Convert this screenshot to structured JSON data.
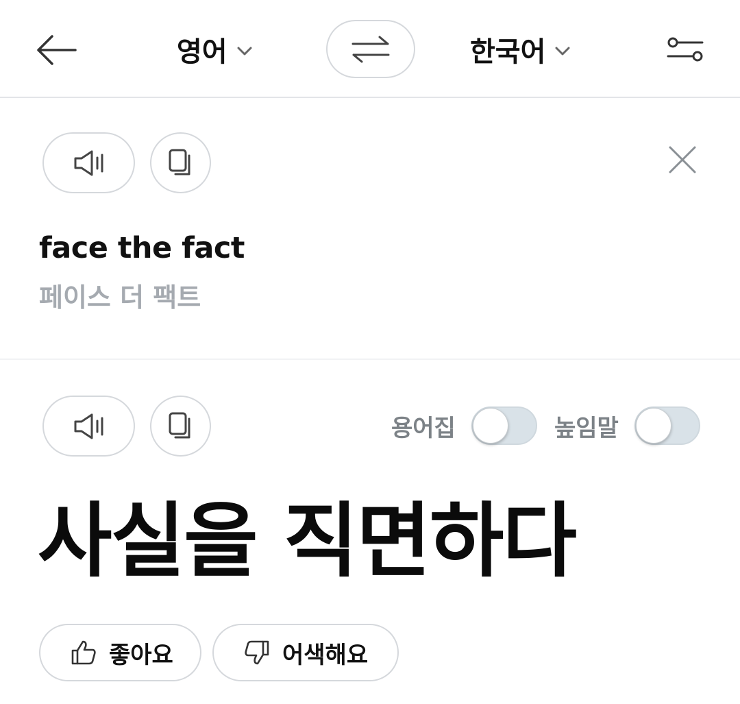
{
  "header": {
    "source_language": "영어",
    "target_language": "한국어"
  },
  "source": {
    "text": "face the fact",
    "pronunciation": "페이스 더 팩트"
  },
  "result": {
    "glossary_label": "용어집",
    "honorific_label": "높임말",
    "glossary_on": false,
    "honorific_on": false,
    "translation": "사실을 직면하다"
  },
  "feedback": {
    "like_label": "좋아요",
    "awkward_label": "어색해요"
  },
  "icons": {
    "back": "arrow-left-icon",
    "chevron": "chevron-down-icon",
    "swap": "swap-arrows-icon",
    "settings": "sliders-icon",
    "speaker": "speaker-icon",
    "copy": "copy-icon",
    "close": "close-icon",
    "thumbs_up": "thumbs-up-icon",
    "thumbs_down": "thumbs-down-icon"
  },
  "colors": {
    "text_primary": "#111111",
    "text_muted": "#a5aab0",
    "toggle_off_track": "#d9e2e8",
    "border": "#d5d8dc"
  }
}
